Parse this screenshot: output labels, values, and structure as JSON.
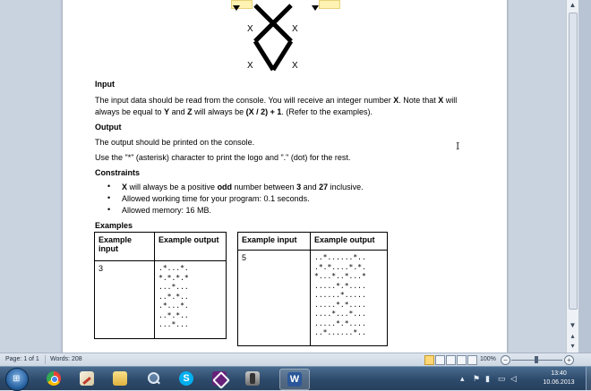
{
  "logo": {
    "marks": [
      "X",
      "X",
      "X",
      "X"
    ]
  },
  "document": {
    "input_heading": "Input",
    "input_line1_a": "The input data should be read from the console. You will receive an integer number ",
    "input_line1_b": "X",
    "input_line1_c": ". Note that ",
    "input_line1_d": "X",
    "input_line1_e": " will",
    "input_line2_a": "always be equal to ",
    "input_line2_b": "Y",
    "input_line2_c": " and ",
    "input_line2_d": "Z",
    "input_line2_e": " will always be ",
    "input_line2_f": "(X / 2) + 1",
    "input_line2_g": ". (Refer to the examples).",
    "output_heading": "Output",
    "output_line1": "The output should be printed on the console.",
    "output_line2": "Use the \"*\" (asterisk) character to print the logo and \".\" (dot) for the rest.",
    "constraints_heading": "Constraints",
    "constraints": {
      "c1_a": "X",
      "c1_b": " will always be a positive ",
      "c1_c": "odd",
      "c1_d": " number between ",
      "c1_e": "3",
      "c1_f": " and ",
      "c1_g": "27",
      "c1_h": " inclusive.",
      "c2": "Allowed working time for your program: 0.1 seconds.",
      "c3": "Allowed memory: 16 MB."
    },
    "examples_heading": "Examples",
    "example1": {
      "header_input": "Example input",
      "header_output": "Example output",
      "input": "3",
      "output": ".*...*.\n*.*.*.*\n...*...\n..*.*..\n.*...*.\n..*.*..\n...*..."
    },
    "example2": {
      "header_input": "Example input",
      "header_output": "Example output",
      "input": "5",
      "output": "..*......*..\n.*.*....*.*.\n*...*..*...*\n.....*.*....\n......*.....\n.....*.*....\n....*...*...\n.....*.*....\n..*......*.."
    }
  },
  "statusbar": {
    "page": "Page: 1 of 1",
    "words": "Words: 208",
    "zoom": "100%",
    "minus": "−",
    "plus": "+"
  },
  "taskbar": {
    "start_glyph": "⊞",
    "apps": [
      "chrome",
      "paint",
      "explorer",
      "magnifier",
      "skype",
      "visual-studio",
      "tool",
      "word"
    ],
    "clock_time": "13:40",
    "clock_date": "10.06.2013"
  },
  "colors": {
    "taskbar": "#2d4a6b",
    "chrome": "#34a853",
    "skype": "#00aff0",
    "visual_studio": "#68217a",
    "word": "#2b579a"
  }
}
